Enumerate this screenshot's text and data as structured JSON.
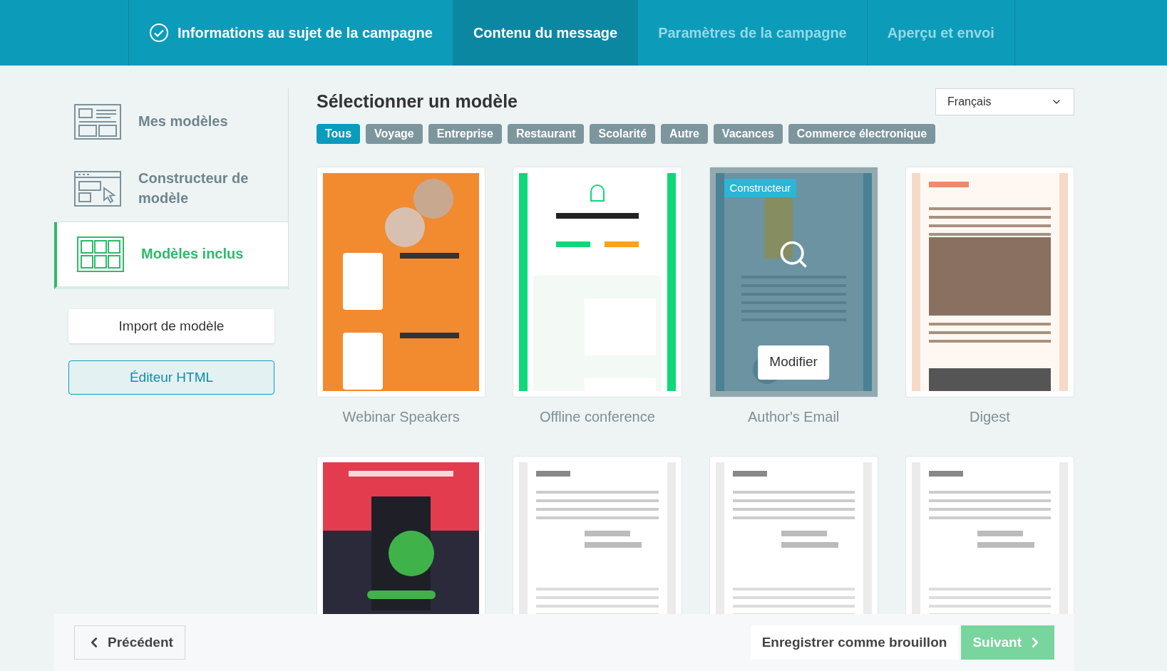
{
  "steps": [
    {
      "label": "Informations au sujet de la campagne",
      "kind": "done"
    },
    {
      "label": "Contenu du message",
      "kind": "active"
    },
    {
      "label": "Paramètres de la campagne",
      "kind": "todo"
    },
    {
      "label": "Aperçu et envoi",
      "kind": "todo"
    }
  ],
  "sidebar": {
    "items": [
      {
        "label": "Mes modèles",
        "kind": "layout",
        "selected": false
      },
      {
        "label": "Constructeur de modèle",
        "kind": "builder",
        "selected": false
      },
      {
        "label": "Modèles inclus",
        "kind": "grid",
        "selected": true
      }
    ],
    "import_button": "Import de modèle",
    "html_button": "Éditeur HTML"
  },
  "title": "Sélectionner un modèle",
  "language": {
    "value": "Français"
  },
  "filters": [
    {
      "label": "Tous",
      "selected": true
    },
    {
      "label": "Voyage",
      "selected": false
    },
    {
      "label": "Entreprise",
      "selected": false
    },
    {
      "label": "Restaurant",
      "selected": false
    },
    {
      "label": "Scolarité",
      "selected": false
    },
    {
      "label": "Autre",
      "selected": false
    },
    {
      "label": "Vacances",
      "selected": false
    },
    {
      "label": "Commerce électronique",
      "selected": false
    }
  ],
  "templates": [
    {
      "name": "Webinar Speakers",
      "kind": "orange",
      "hovered": false
    },
    {
      "name": "Offline conference",
      "kind": "green",
      "hovered": false
    },
    {
      "name": "Author's Email",
      "kind": "blue",
      "hovered": true,
      "badge": "Constructeur",
      "hover_button": "Modifier"
    },
    {
      "name": "Digest",
      "kind": "cream",
      "hovered": false
    },
    {
      "kind": "red",
      "hovered": false
    },
    {
      "kind": "gray",
      "hovered": false
    },
    {
      "kind": "gray",
      "hovered": false
    },
    {
      "kind": "gray",
      "hovered": false
    }
  ],
  "footer": {
    "back": "Précédent",
    "draft": "Enregistrer comme brouillon",
    "next": "Suivant"
  }
}
